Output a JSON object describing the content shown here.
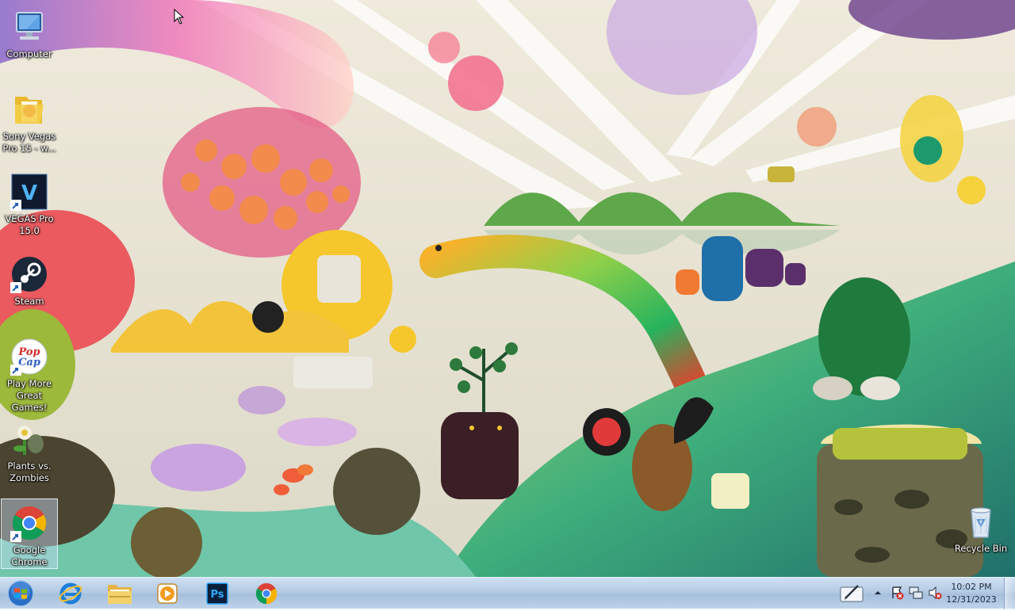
{
  "desktop": {
    "icons": [
      {
        "name": "computer",
        "label": "Computer",
        "icon": "computer-icon",
        "shortcut": false
      },
      {
        "name": "sony-vegas-pro-15",
        "label": "Sony Vegas Pro 15 - w...",
        "icon": "folder-icon",
        "shortcut": false
      },
      {
        "name": "vegas-pro-15",
        "label": "VEGAS Pro 15.0",
        "icon": "vegas-icon",
        "shortcut": true
      },
      {
        "name": "steam",
        "label": "Steam",
        "icon": "steam-icon",
        "shortcut": true
      },
      {
        "name": "play-more-great-games",
        "label": "Play More Great Games!",
        "icon": "popcap-icon",
        "shortcut": true
      },
      {
        "name": "plants-vs-zombies",
        "label": "Plants vs. Zombies",
        "icon": "pvz-icon",
        "shortcut": false
      },
      {
        "name": "google-chrome",
        "label": "Google Chrome",
        "icon": "chrome-icon",
        "shortcut": true,
        "selected": true
      }
    ],
    "recycle_bin": {
      "label": "Recycle Bin",
      "icon": "recycle-bin-icon"
    },
    "popcap_logo_text": "PopCap"
  },
  "taskbar": {
    "pinned": [
      {
        "name": "internet-explorer",
        "icon": "internet-explorer-icon"
      },
      {
        "name": "file-explorer",
        "icon": "folder-icon"
      },
      {
        "name": "media-player",
        "icon": "media-player-icon"
      },
      {
        "name": "photoshop",
        "icon": "photoshop-icon",
        "text": "Ps"
      },
      {
        "name": "chrome",
        "icon": "chrome-icon"
      }
    ],
    "tray": {
      "icons": [
        "pen-tablet-icon",
        "show-hidden-icons-icon",
        "action-center-icon",
        "network-icon",
        "volume-muted-icon"
      ]
    },
    "clock": {
      "time": "10:02 PM",
      "date": "12/31/2023"
    }
  }
}
